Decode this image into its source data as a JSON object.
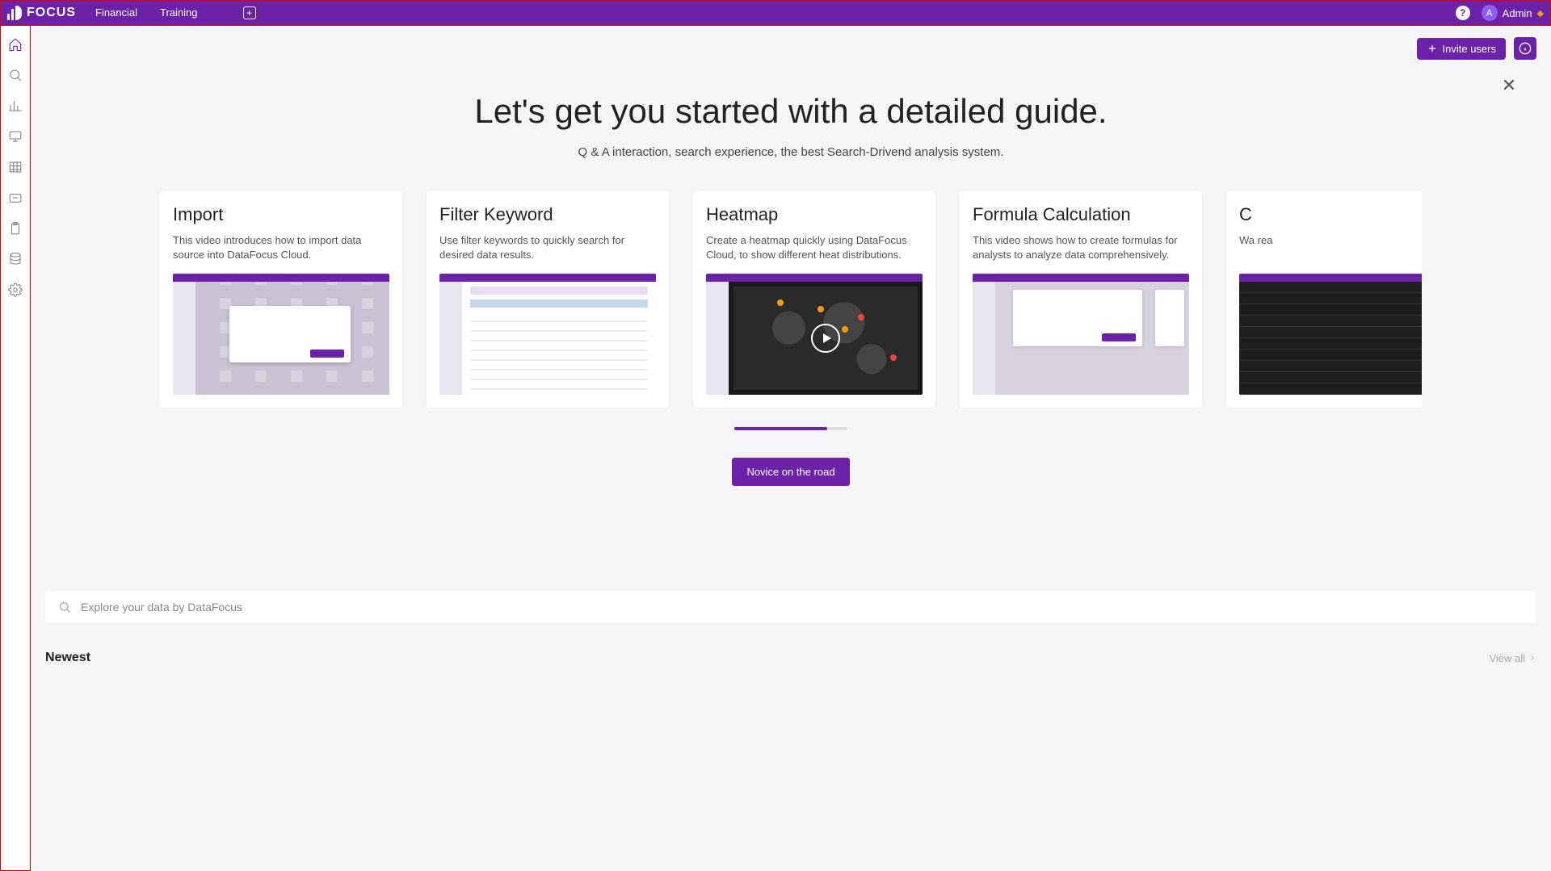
{
  "header": {
    "brand": "FOCUS",
    "tabs": [
      "Financial",
      "Training"
    ],
    "user_initial": "A",
    "user_name": "Admin"
  },
  "toolbar": {
    "invite_label": "Invite users"
  },
  "guide": {
    "title": "Let's get you started with a detailed guide.",
    "subtitle": "Q & A interaction, search experience, the best Search-Drivend analysis system.",
    "novice_button": "Novice on the road",
    "cards": [
      {
        "title": "Import",
        "desc": "This video introduces how to import data source into DataFocus Cloud."
      },
      {
        "title": "Filter Keyword",
        "desc": "Use filter keywords to quickly search for desired data results."
      },
      {
        "title": "Heatmap",
        "desc": "Create a heatmap quickly using DataFocus Cloud, to show different heat distributions."
      },
      {
        "title": "Formula Calculation",
        "desc": "This video shows how to create formulas for analysts to analyze data comprehensively."
      },
      {
        "title": "C",
        "desc": "Wa rea"
      }
    ]
  },
  "search": {
    "placeholder": "Explore your data by DataFocus"
  },
  "newest": {
    "heading": "Newest",
    "view_all": "View all"
  }
}
